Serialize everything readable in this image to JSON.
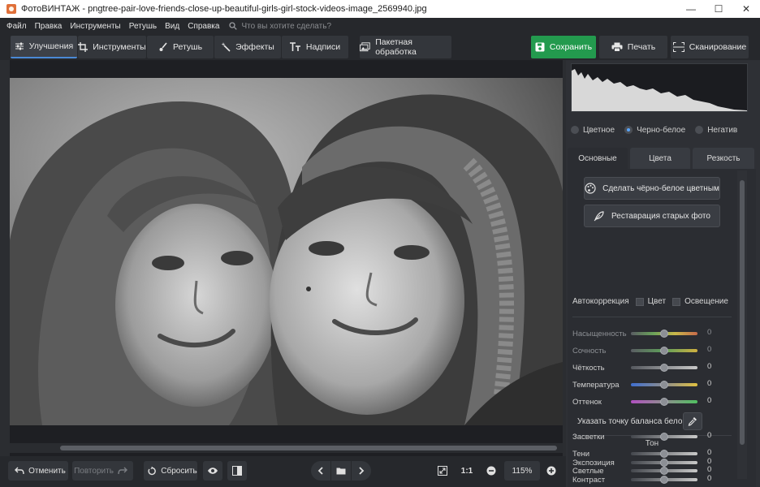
{
  "window": {
    "title": "ФотоВИНТАЖ - pngtree-pair-love-friends-close-up-beautiful-girls-girl-stock-videos-image_2569940.jpg",
    "controls": [
      "—",
      "☐",
      "✕"
    ]
  },
  "menu": {
    "items": [
      "Файл",
      "Правка",
      "Инструменты",
      "Ретушь",
      "Вид",
      "Справка"
    ],
    "search_placeholder": "Что вы хотите сделать?"
  },
  "toolbar": {
    "tabs": [
      "Улучшения",
      "Инструменты",
      "Ретушь",
      "Эффекты",
      "Надписи"
    ],
    "batch": "Пакетная обработка",
    "save": "Сохранить",
    "print": "Печать",
    "scan": "Сканирование"
  },
  "colors": {
    "accent": "#4a8ad6",
    "save": "#239a4e"
  },
  "panel": {
    "modes": [
      "Цветное",
      "Черно-белое",
      "Негатив"
    ],
    "selected_mode": "Черно-белое",
    "tabs": [
      "Основные",
      "Цвета",
      "Резкость"
    ],
    "colorize_button": "Сделать чёрно-белое цветным",
    "restore_button": "Реставрация старых фото",
    "autocorrection": {
      "label": "Автокоррекция",
      "color": "Цвет",
      "light": "Освещение"
    },
    "sliders": [
      {
        "label": "Насыщенность",
        "value": "0"
      },
      {
        "label": "Сочность",
        "value": "0"
      },
      {
        "label": "Чёткость",
        "value": "0"
      },
      {
        "label": "Температура",
        "value": "0"
      },
      {
        "label": "Оттенок",
        "value": "0"
      }
    ],
    "white_balance": "Указать точку баланса белого",
    "tone_header": "Тон",
    "tone_sliders": [
      {
        "label": "Экспозиция",
        "value": "0"
      },
      {
        "label": "Контраст",
        "value": "0"
      },
      {
        "label": "Засветки",
        "value": "0"
      },
      {
        "label": "Тени",
        "value": "0"
      },
      {
        "label": "Светлые",
        "value": "0"
      }
    ]
  },
  "bottom": {
    "undo": "Отменить",
    "redo": "Повторить",
    "reset": "Сбросить",
    "ratio": "1:1",
    "zoom": "115%"
  }
}
